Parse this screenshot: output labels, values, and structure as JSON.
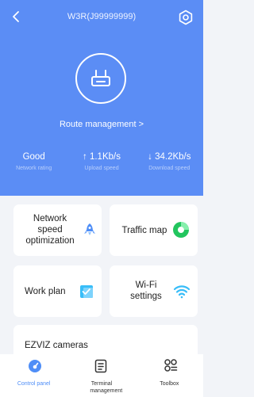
{
  "header": {
    "title": "W3R(J99999999)",
    "route_management": "Route management >"
  },
  "stats": [
    {
      "value": "Good",
      "label": "Network rating"
    },
    {
      "value": "↑ 1.1Kb/s",
      "label": "Upload speed"
    },
    {
      "value": "↓ 34.2Kb/s",
      "label": "Download speed"
    }
  ],
  "cards": {
    "network_speed": "Network speed optimization",
    "traffic_map": "Traffic map",
    "work_plan": "Work plan",
    "wifi_settings": "Wi-Fi settings",
    "ezviz": "EZVIZ cameras"
  },
  "nav": [
    {
      "label": "Control panel",
      "icon": "control-panel-icon",
      "active": true
    },
    {
      "label": "Terminal management",
      "icon": "terminal-icon",
      "active": false
    },
    {
      "label": "Toolbox",
      "icon": "toolbox-icon",
      "active": false
    }
  ],
  "colors": {
    "header_bg": "#5b8df5",
    "accent": "#3b82f6",
    "traffic_green": "#22c55e",
    "wifi_blue": "#38bdf8"
  }
}
